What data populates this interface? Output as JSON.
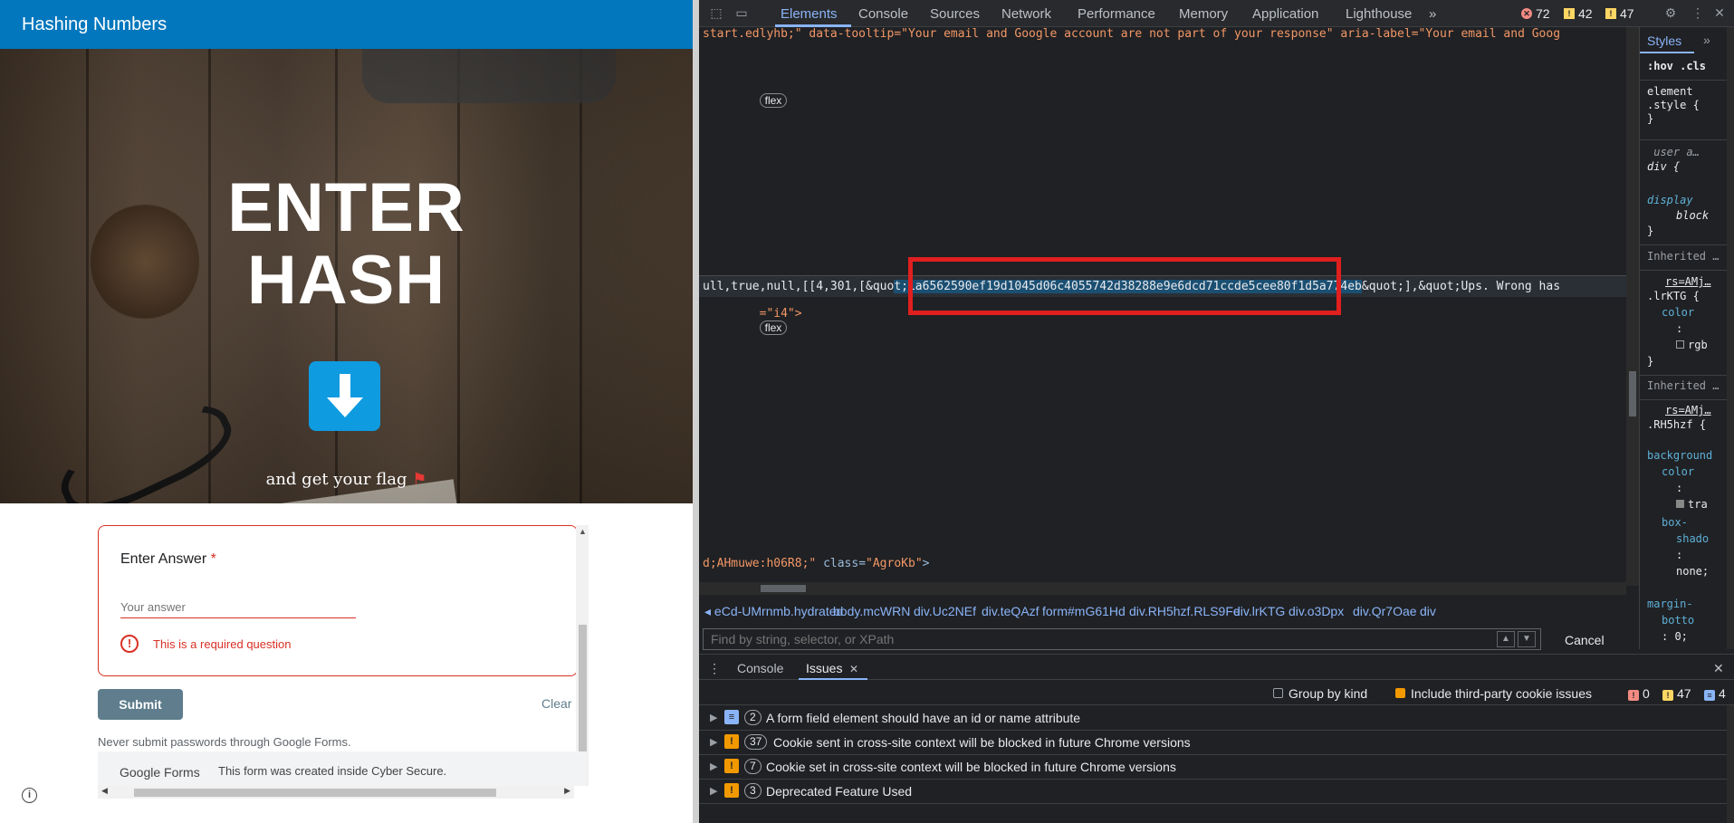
{
  "form": {
    "topbar_title": "Hashing Numbers",
    "hero_title_line1": "ENTER",
    "hero_title_line2": "HASH",
    "hero_subtitle": "and get your flag",
    "question_label": "Enter Answer",
    "required_star": "*",
    "answer_placeholder": "Your answer",
    "error_message": "This is a required question",
    "submit_label": "Submit",
    "clear_label": "Clear",
    "never_submit_text": "Never submit passwords through Google Forms.",
    "footer_logo": "Google Forms",
    "footer_text": "This form was created inside Cyber Secure."
  },
  "devtools": {
    "tabs": [
      "Elements",
      "Console",
      "Sources",
      "Network",
      "Performance",
      "Memory",
      "Application",
      "Lighthouse"
    ],
    "more_tabs": "»",
    "error_count": "72",
    "warning_count": "42",
    "info_count": "47",
    "elements": {
      "line1": "start.edlyhb;\" data-tooltip=\"Your email and Google account are not part of your response\" aria-label=\"Your email and Goog",
      "badge_flex_1": "flex",
      "hl_before": "ull,true,null,[[4,301,[&quo",
      "hl_hash": "t;1a6562590ef19d1045d06c4055742d38288e9e6dcd71ccde5cee80f1d5a774eb",
      "hl_after": "&quot;],&quot;Ups. Wrong has",
      "line_i4": "=\"i4\">",
      "badge_flex_2": "flex",
      "line_agrokb_pre": "d;AHmuwe:h06R8;\" ",
      "line_agrokb_attr": "class=",
      "line_agrokb_val": "\"AgroKb\"",
      "line_agrokb_end": ">"
    },
    "breadcrumbs": [
      "◂ eCd-UMrnmb.hydrated",
      "body.mcWRN",
      "div.Uc2NEf",
      "div.teQAzf",
      "form#mG61Hd",
      "div.RH5hzf.RLS9Fe",
      "div.lrKTG",
      "div.o3Dpx",
      "div.Qr7Oae",
      "div"
    ],
    "find_placeholder": "Find by string, selector, or XPath",
    "cancel_label": "Cancel",
    "styles": {
      "tab_label": "Styles",
      "more": "»",
      "filter": ":hov .cls",
      "element_style": "element\n.style {\n}",
      "ua_comment": " user a…",
      "div_rule": "div {",
      "display_prop": "display",
      "display_val": "block",
      "close_brace": "}",
      "inherited1": "Inherited …",
      "rs1": "rs=AMj…",
      "selector1": ".lrKTG {",
      "color_prop": "color",
      "color_val": "rgb",
      "inherited2": "Inherited …",
      "rs2": "rs=AMj…",
      "selector2": ".RH5hzf {",
      "bg_prop": "background",
      "bg_prop2": "color",
      "bg_val": "tra",
      "shadow_prop": "box-",
      "shadow_prop2": "shado",
      "shadow_val": "none;",
      "margin_prop": "margin-",
      "margin_prop2": "botto",
      "margin_val": ": 0;"
    },
    "drawer": {
      "tab_console": "Console",
      "tab_issues": "Issues",
      "close_x": "✕",
      "group_by_kind": "Group by kind",
      "include_third_party": "Include third-party cookie issues",
      "issues_errors": "0",
      "issues_warnings": "47",
      "issues_info": "4",
      "issues": [
        {
          "count": "2",
          "text": "A form field element should have an id or name attribute",
          "kind": "info"
        },
        {
          "count": "37",
          "text": "Cookie sent in cross-site context will be blocked in future Chrome versions",
          "kind": "warning"
        },
        {
          "count": "7",
          "text": "Cookie set in cross-site context will be blocked in future Chrome versions",
          "kind": "warning"
        },
        {
          "count": "3",
          "text": "Deprecated Feature Used",
          "kind": "warning"
        }
      ]
    }
  },
  "colors": {
    "form_topbar": "#0277bd",
    "error_red": "#d93025",
    "devtools_bg": "#202124",
    "accent_blue": "#8ab4f8",
    "annotation_red": "#e01f1f",
    "hash_selection": "#1b4f72"
  }
}
